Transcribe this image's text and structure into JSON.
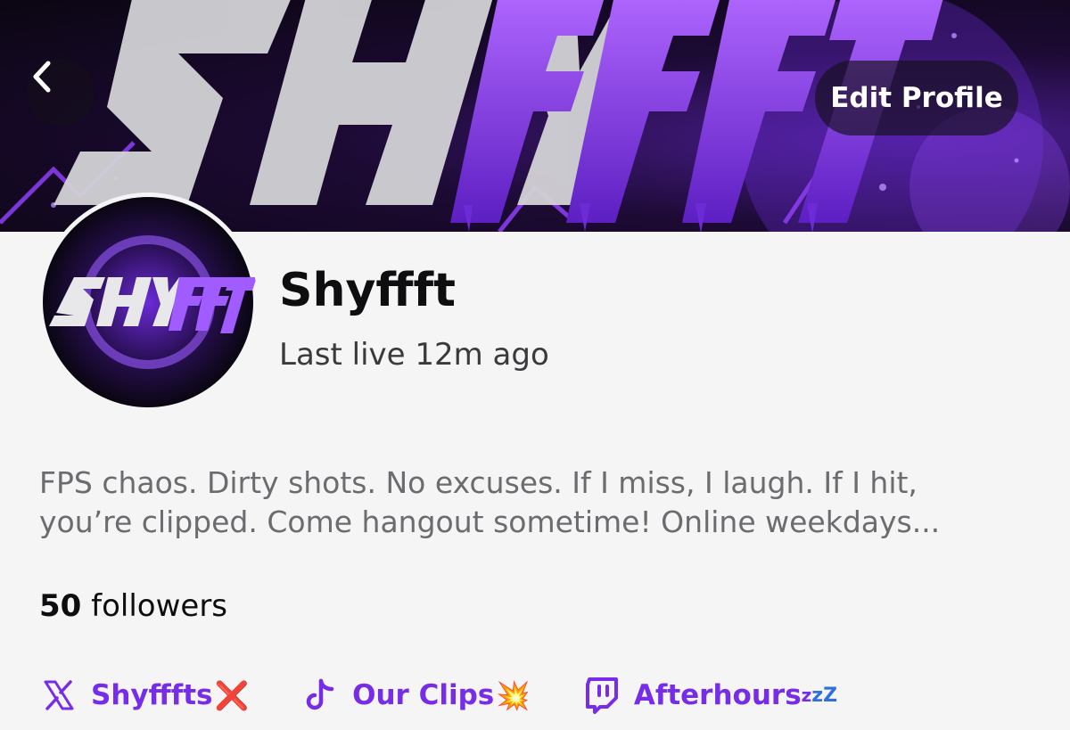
{
  "header": {
    "back_icon": "chevron-left-icon",
    "edit_profile_label": "Edit Profile",
    "banner_brand_text": "SHYFFFT"
  },
  "profile": {
    "avatar_brand_text": "SHYFFFT",
    "display_name": "Shyffft",
    "last_live": "Last live 12m ago",
    "bio_lines": [
      "FPS chaos. Dirty shots. No excuses. If I miss, I laugh. If I hit,",
      "you’re clipped. Come hangout sometime! Online weekdays..."
    ],
    "followers_count": "50",
    "followers_label": "followers"
  },
  "socials": [
    {
      "icon": "x-logo-icon",
      "label": "Shyfffts",
      "suffix": "❌"
    },
    {
      "icon": "tiktok-icon",
      "label": "Our Clips",
      "suffix": "💥"
    },
    {
      "icon": "twitch-icon",
      "label": "Afterhours",
      "suffix_sub": "z",
      "suffix_sup": "zZ"
    }
  ],
  "colors": {
    "accent": "#772ce8",
    "banner_purple": "#8a3cf0",
    "background": "#f5f5f5",
    "text": "#0e0e10"
  }
}
